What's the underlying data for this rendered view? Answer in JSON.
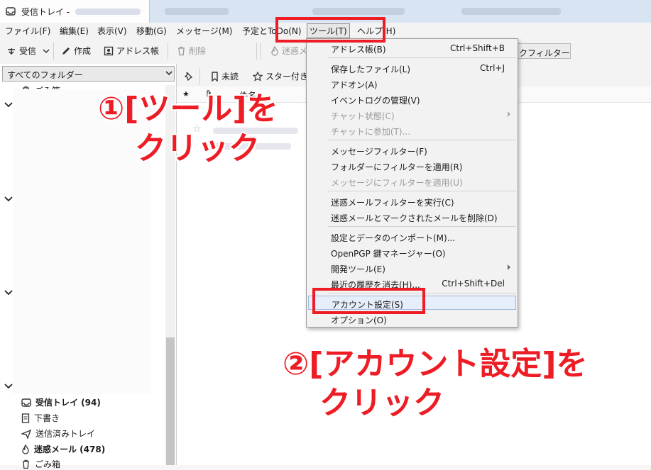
{
  "window": {
    "tab_title": "受信トレイ -"
  },
  "menubar": [
    {
      "label": "ファイル(F)"
    },
    {
      "label": "編集(E)"
    },
    {
      "label": "表示(V)"
    },
    {
      "label": "移動(G)"
    },
    {
      "label": "メッセージ(M)"
    },
    {
      "label": "予定とToDo(N)"
    },
    {
      "label": "ツール(T)"
    },
    {
      "label": "ヘルプ(H)"
    }
  ],
  "toolbar": {
    "get_mail": "受信",
    "write": "作成",
    "address_book": "アドレス帳",
    "delete": "削除",
    "junk": "迷惑メ",
    "quick_filter": "クフィルター"
  },
  "folder_pane": {
    "selector": "すべてのフォルダー",
    "top_folder": "ごみ箱",
    "folders": [
      {
        "label": "受信トレイ (94)",
        "icon": "inbox-icon",
        "bold": true
      },
      {
        "label": "下書き",
        "icon": "drafts-icon",
        "bold": false
      },
      {
        "label": "送信済みトレイ",
        "icon": "sent-icon",
        "bold": false
      },
      {
        "label": "迷惑メール (478)",
        "icon": "junk-icon",
        "bold": true
      },
      {
        "label": "ごみ箱",
        "icon": "trash-icon",
        "bold": false
      }
    ]
  },
  "thread_toolbar": {
    "unread": "未読",
    "starred": "スター付き"
  },
  "thread_columns": {
    "subject": "件名"
  },
  "tools_menu": {
    "items": [
      {
        "label": "アドレス帳(B)",
        "shortcut": "Ctrl+Shift+B",
        "disabled": false
      },
      {
        "label": "保存したファイル(L)",
        "shortcut": "Ctrl+J",
        "disabled": false
      },
      {
        "label": "アドオン(A)",
        "shortcut": "",
        "disabled": false
      },
      {
        "label": "イベントログの管理(V)",
        "shortcut": "",
        "disabled": false
      },
      {
        "label": "チャット状態(C)",
        "shortcut": "",
        "disabled": true,
        "submenu": true
      },
      {
        "label": "チャットに参加(T)...",
        "shortcut": "",
        "disabled": true
      },
      {
        "label": "メッセージフィルター(F)",
        "shortcut": "",
        "disabled": false
      },
      {
        "label": "フォルダーにフィルターを適用(R)",
        "shortcut": "",
        "disabled": false
      },
      {
        "label": "メッセージにフィルターを適用(U)",
        "shortcut": "",
        "disabled": true
      },
      {
        "label": "迷惑メールフィルターを実行(C)",
        "shortcut": "",
        "disabled": false
      },
      {
        "label": "迷惑メールとマークされたメールを削除(D)",
        "shortcut": "",
        "disabled": false
      },
      {
        "label": "設定とデータのインポート(M)...",
        "shortcut": "",
        "disabled": false
      },
      {
        "label": "OpenPGP 鍵マネージャー(O)",
        "shortcut": "",
        "disabled": false
      },
      {
        "label": "開発ツール(E)",
        "shortcut": "",
        "disabled": false,
        "submenu": true
      },
      {
        "label": "最近の履歴を消去(H)...",
        "shortcut": "Ctrl+Shift+Del",
        "disabled": false
      },
      {
        "label": "アカウント設定(S)",
        "shortcut": "",
        "disabled": false,
        "highlighted": true
      },
      {
        "label": "オプション(O)",
        "shortcut": "",
        "disabled": false
      }
    ]
  },
  "annotations": {
    "step1_line1": "①[ツール]を",
    "step1_line2": "クリック",
    "step2_line1": "②[アカウント設定]を",
    "step2_line2": "クリック",
    "color": "#ee1c24"
  }
}
